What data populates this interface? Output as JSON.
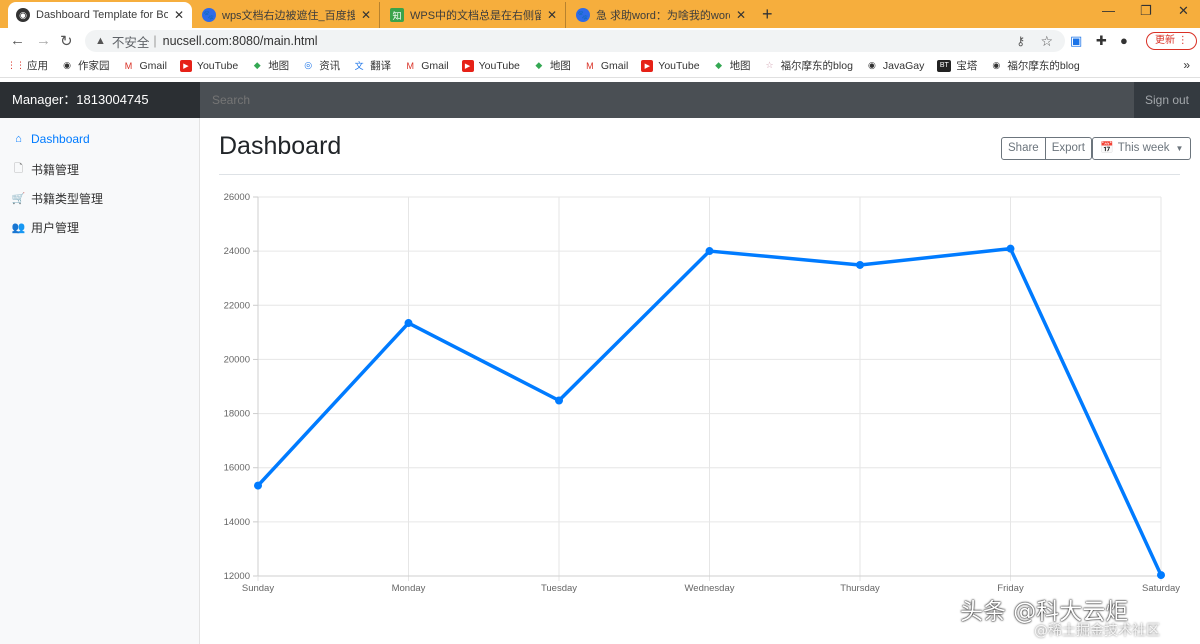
{
  "browser": {
    "tabs": [
      {
        "title": "Dashboard Template for Boot",
        "active": true
      },
      {
        "title": "wps文档右边被遮住_百度搜索",
        "active": false
      },
      {
        "title": "WPS中的文档总是在右侧留下空",
        "active": false
      },
      {
        "title": "急 求助word：为啥我的word打",
        "active": false
      }
    ],
    "new_tab": "+",
    "address": {
      "insecure_label": "不安全",
      "url": "nucsell.com:8080/main.html"
    },
    "update_label": "更新",
    "bookmarks": [
      {
        "label": "应用",
        "icon": "apps-grid-icon"
      },
      {
        "label": "作家园",
        "icon": "globe-icon"
      },
      {
        "label": "Gmail",
        "icon": "gmail-icon"
      },
      {
        "label": "YouTube",
        "icon": "youtube-icon"
      },
      {
        "label": "地图",
        "icon": "maps-icon"
      },
      {
        "label": "资讯",
        "icon": "news-icon"
      },
      {
        "label": "翻译",
        "icon": "translate-icon"
      },
      {
        "label": "Gmail",
        "icon": "gmail-icon"
      },
      {
        "label": "YouTube",
        "icon": "youtube-icon"
      },
      {
        "label": "地图",
        "icon": "maps-icon"
      },
      {
        "label": "Gmail",
        "icon": "gmail-icon"
      },
      {
        "label": "YouTube",
        "icon": "youtube-icon"
      },
      {
        "label": "地图",
        "icon": "maps-icon"
      },
      {
        "label": "福尔摩东的blog",
        "icon": "blog-icon"
      },
      {
        "label": "JavaGay",
        "icon": "globe-icon"
      },
      {
        "label": "宝塔",
        "icon": "bt-icon"
      },
      {
        "label": "福尔摩东的blog",
        "icon": "globe-icon"
      }
    ],
    "bookmarks_more": "»"
  },
  "header": {
    "brand": "Manager：1813004745",
    "search_placeholder": "Search",
    "signout": "Sign out"
  },
  "sidebar": {
    "items": [
      {
        "label": "Dashboard",
        "icon": "home-icon",
        "active": true
      },
      {
        "label": "书籍管理",
        "icon": "file-icon",
        "active": false
      },
      {
        "label": "书籍类型管理",
        "icon": "cart-icon",
        "active": false
      },
      {
        "label": "用户管理",
        "icon": "users-icon",
        "active": false
      }
    ]
  },
  "main": {
    "title": "Dashboard",
    "share_label": "Share",
    "export_label": "Export",
    "range_label": "This week"
  },
  "colors": {
    "line": "#007bff",
    "tabstrip": "#f6ae3d",
    "header": "#343a40"
  },
  "chart_data": {
    "type": "line",
    "categories": [
      "Sunday",
      "Monday",
      "Tuesday",
      "Wednesday",
      "Thursday",
      "Friday",
      "Saturday"
    ],
    "series": [
      {
        "values": [
          15339,
          21345,
          18483,
          24003,
          23489,
          24092,
          12034
        ]
      }
    ],
    "ylim": [
      12000,
      26000
    ],
    "yticks": [
      12000,
      14000,
      16000,
      18000,
      20000,
      22000,
      24000,
      26000
    ],
    "grid": true,
    "legend": "none"
  },
  "watermark": {
    "line1": "头条 @科大云炬",
    "line2": "@稀土掘金技术社区"
  }
}
